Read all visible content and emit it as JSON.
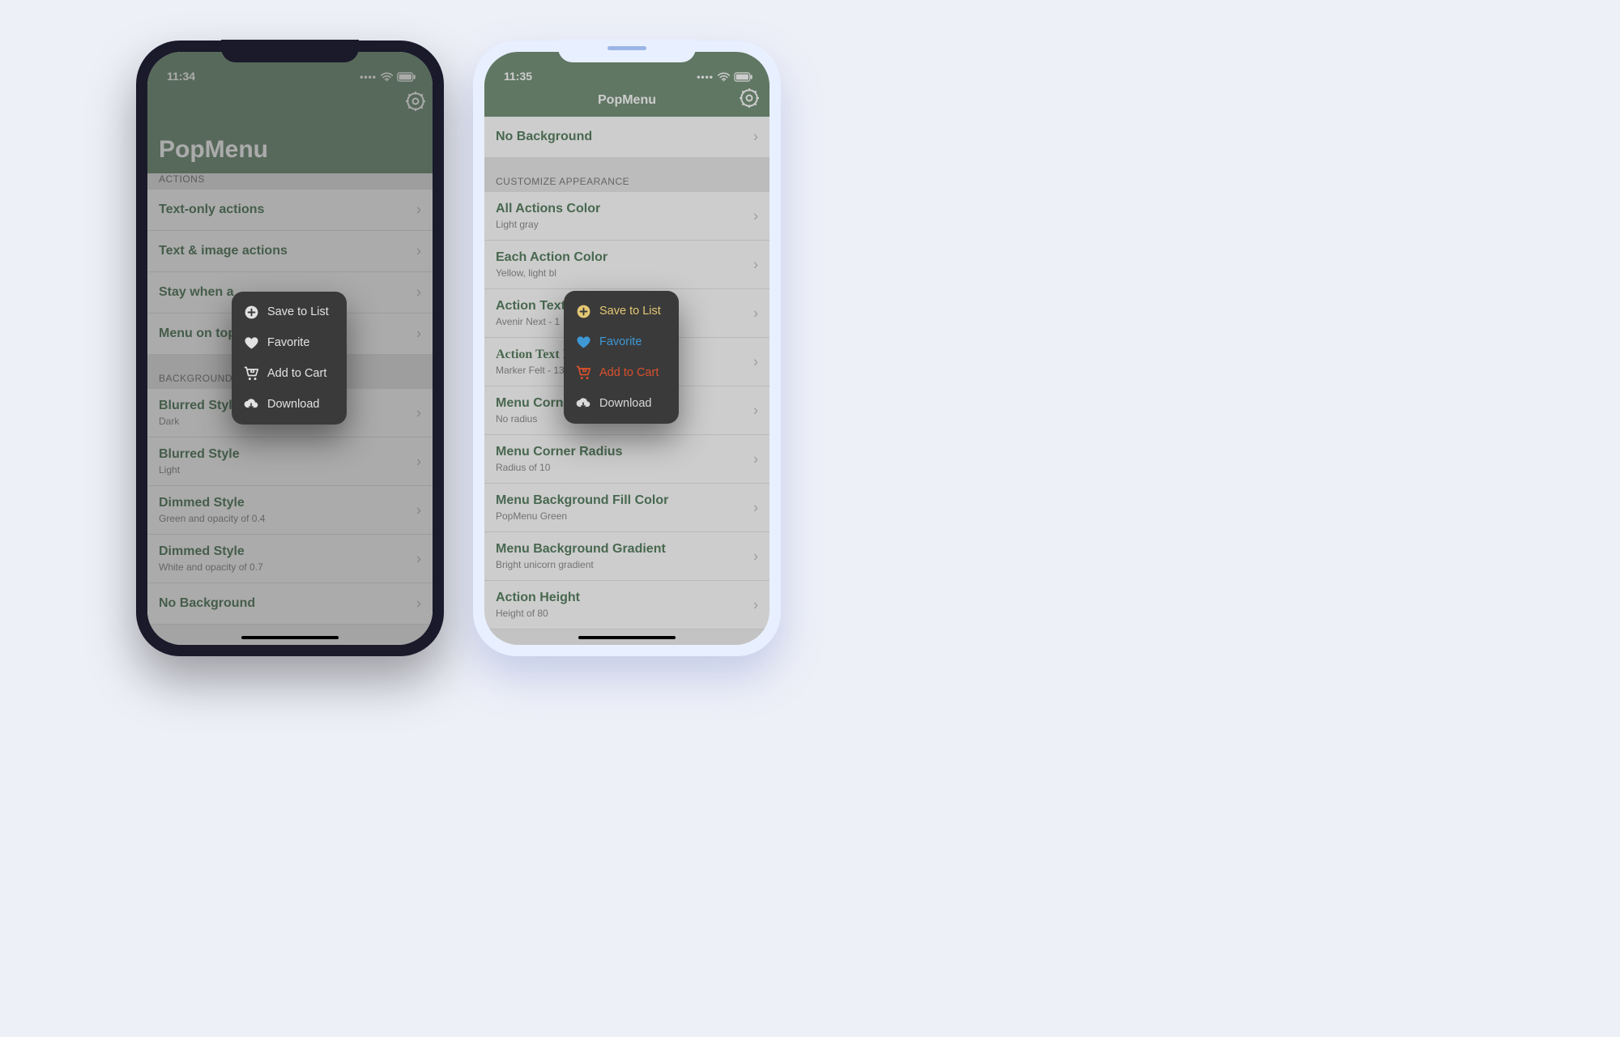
{
  "phone1": {
    "time": "11:34",
    "appTitle": "PopMenu",
    "sections": [
      {
        "header": "ACTIONS",
        "rows": [
          {
            "title": "Text-only actions"
          },
          {
            "title": "Text & image actions"
          },
          {
            "title": "Stay when a"
          },
          {
            "title": "Menu on top"
          }
        ]
      },
      {
        "header": "BACKGROUND",
        "rows": [
          {
            "title": "Blurred Style",
            "sub": "Dark"
          },
          {
            "title": "Blurred Style",
            "sub": "Light"
          },
          {
            "title": "Dimmed Style",
            "sub": "Green and opacity of 0.4"
          },
          {
            "title": "Dimmed Style",
            "sub": "White and opacity of 0.7"
          },
          {
            "title": "No Background"
          }
        ]
      }
    ],
    "popup": [
      {
        "icon": "plus-circle",
        "label": "Save to List"
      },
      {
        "icon": "heart",
        "label": "Favorite"
      },
      {
        "icon": "cart",
        "label": "Add to Cart"
      },
      {
        "icon": "download-cloud",
        "label": "Download"
      }
    ]
  },
  "phone2": {
    "time": "11:35",
    "appTitle": "PopMenu",
    "topRow": {
      "title": "No Background"
    },
    "sectionHeader": "CUSTOMIZE APPEARANCE",
    "rows": [
      {
        "title": "All Actions Color",
        "sub": "Light gray"
      },
      {
        "title": "Each Action Color",
        "sub": "Yellow, light bl"
      },
      {
        "title": "Action Text F",
        "sub": "Avenir Next - 1"
      },
      {
        "title": "Action Text F",
        "sub": "Marker Felt - 13",
        "marker": true
      },
      {
        "title": "Menu Corner Radius",
        "sub": "No radius"
      },
      {
        "title": "Menu Corner Radius",
        "sub": "Radius of 10"
      },
      {
        "title": "Menu Background Fill Color",
        "sub": "PopMenu Green"
      },
      {
        "title": "Menu Background Gradient",
        "sub": "Bright unicorn gradient"
      },
      {
        "title": "Action Height",
        "sub": "Height of 80"
      }
    ],
    "popup": [
      {
        "icon": "plus-circle",
        "label": "Save to List",
        "color": "#e5c874"
      },
      {
        "icon": "heart",
        "label": "Favorite",
        "color": "#3e98d4"
      },
      {
        "icon": "cart",
        "label": "Add to Cart",
        "color": "#d9512d"
      },
      {
        "icon": "download-cloud",
        "label": "Download",
        "color": "#d9d9d9"
      }
    ]
  }
}
